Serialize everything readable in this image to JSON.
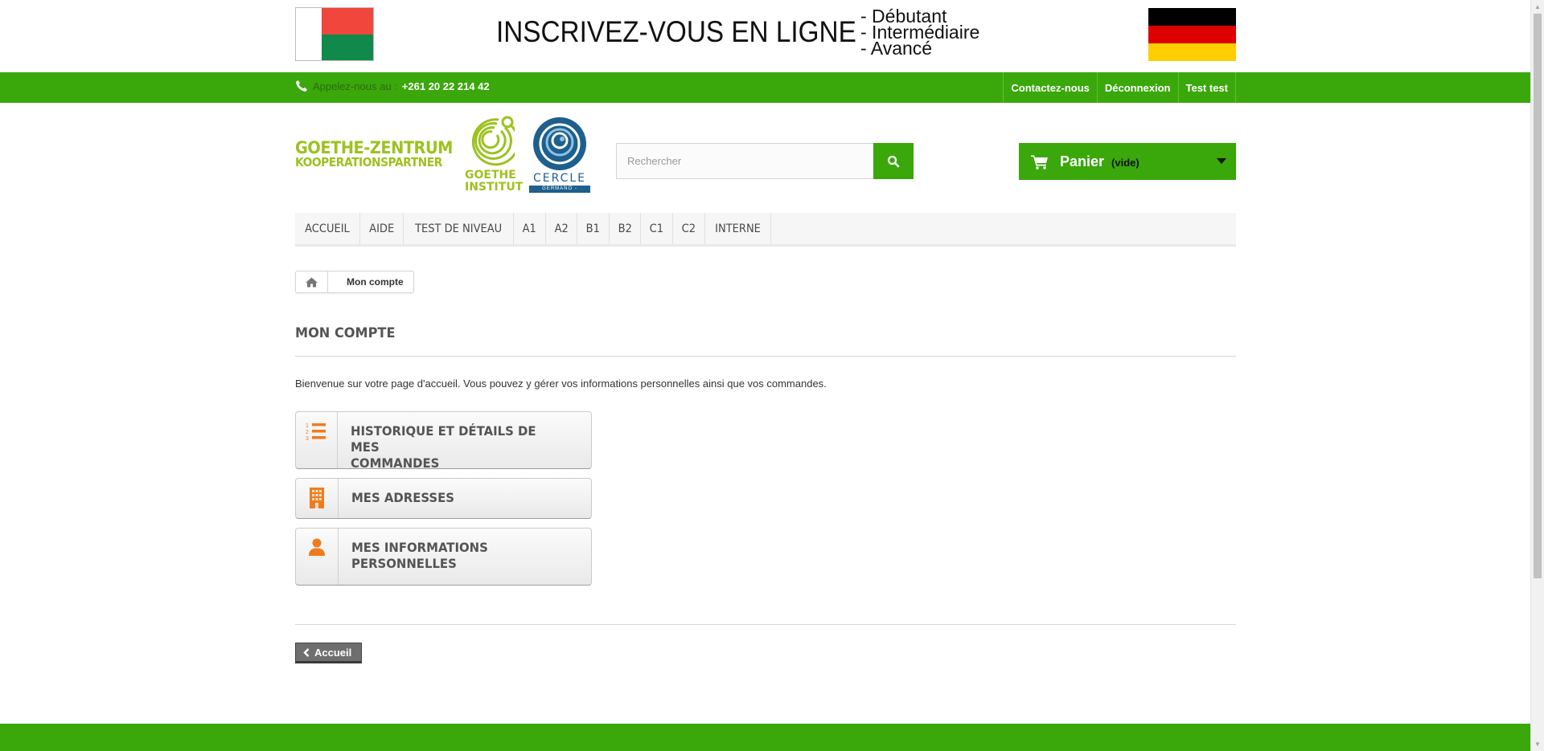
{
  "banner": {
    "title": "INSCRIVEZ-VOUS EN LIGNE",
    "levels": [
      "- Débutant",
      "- Intermédiaire",
      "- Avancé"
    ],
    "flag_madagascar_colors": [
      "#ffffff",
      "#f0463c",
      "#108a4a"
    ],
    "flag_germany_colors": [
      "#000000",
      "#dd0000",
      "#ffce00"
    ]
  },
  "topbar": {
    "phone_label": "Appelez-nous au :",
    "phone_number": "+261 20 22 214 42",
    "links": [
      "Contactez-nous",
      "Déconnexion",
      "Test test"
    ],
    "color": "#3aa70b"
  },
  "logos": {
    "goethe_zentrum_line1": "GOETHE-ZENTRUM",
    "goethe_zentrum_line2": "KOOPERATIONSPARTNER",
    "goethe_institut_line1": "GOETHE",
    "goethe_institut_line2": "INSTITUT",
    "cercle_name": "CERCLE",
    "cercle_sub": "GERMANO - MALAGASY"
  },
  "search": {
    "placeholder": "Rechercher",
    "icon": "search-icon"
  },
  "cart": {
    "label": "Panier",
    "status": "(vide)",
    "icon": "cart-icon"
  },
  "menu": [
    "ACCUEIL",
    "AIDE",
    "TEST DE NIVEAU",
    "A1",
    "A2",
    "B1",
    "B2",
    "C1",
    "C2",
    "INTERNE"
  ],
  "breadcrumb": {
    "home_icon": "home-icon",
    "current": "Mon compte"
  },
  "page": {
    "heading": "MON COMPTE",
    "info": "Bienvenue sur votre page d'accueil. Vous pouvez y gérer vos informations personnelles ainsi que vos commandes.",
    "accent": "#f07b1d",
    "buttons": [
      {
        "line1": "HISTORIQUE ET DÉTAILS DE MES",
        "line2": "COMMANDES",
        "icon": "ordered-list-icon"
      },
      {
        "line1": "MES ADRESSES",
        "line2": "",
        "icon": "building-icon"
      },
      {
        "line1": "MES INFORMATIONS",
        "line2": "PERSONNELLES",
        "icon": "user-icon"
      }
    ],
    "back_label": "Accueil"
  }
}
